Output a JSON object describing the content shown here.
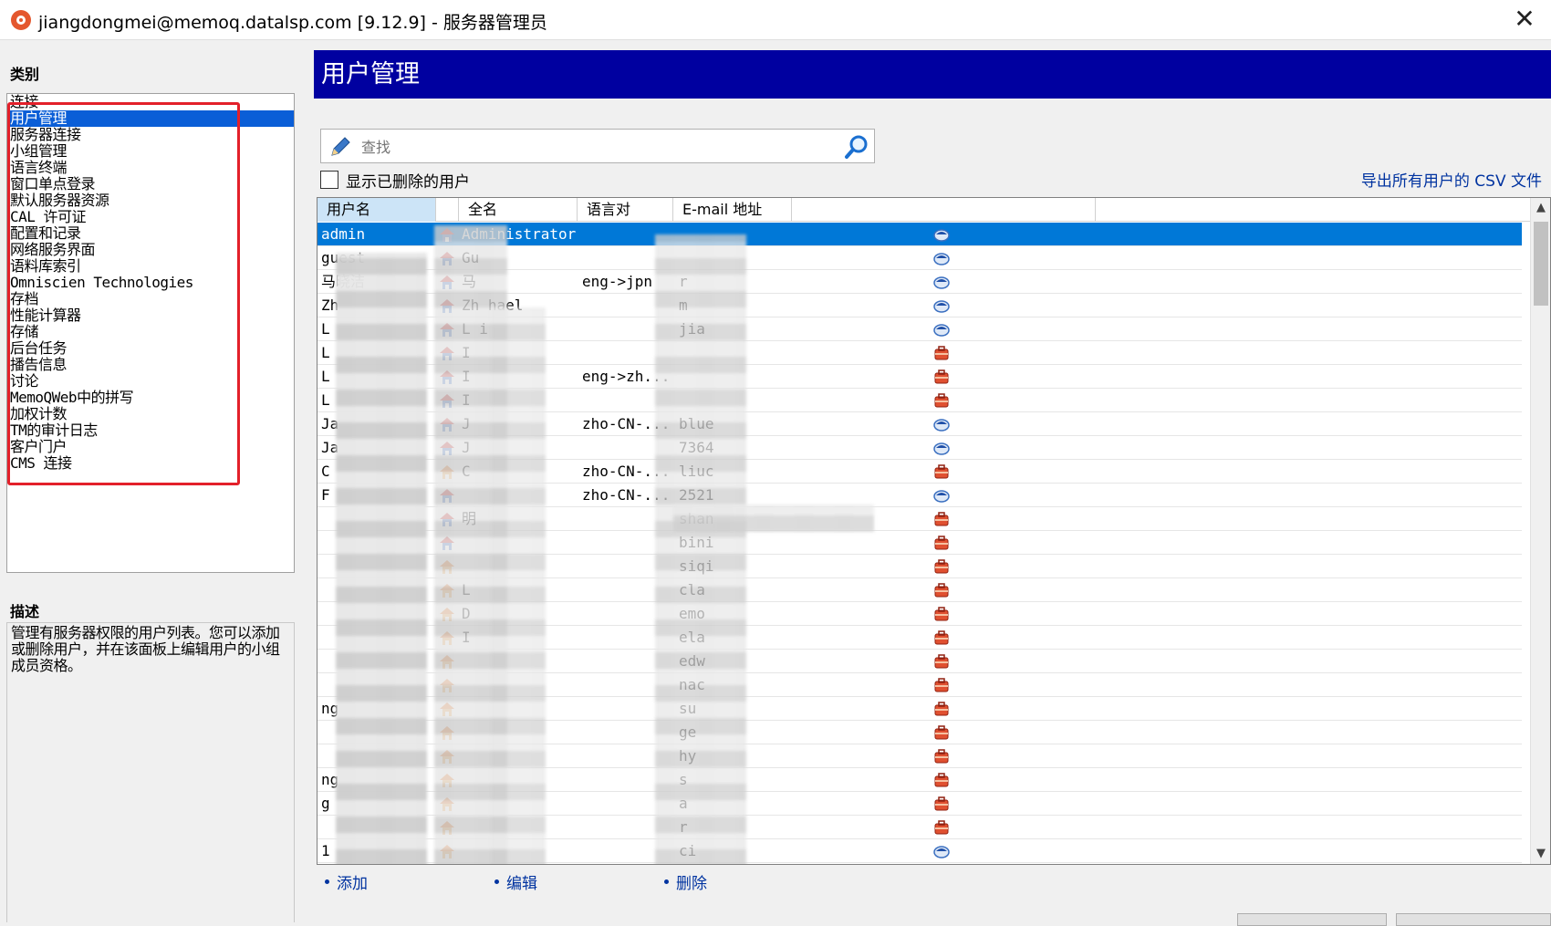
{
  "window": {
    "title": "jiangdongmei@memoq.datalsp.com [9.12.9] - 服务器管理员",
    "close_glyph": "✕"
  },
  "left": {
    "category_heading": "类别",
    "categories": [
      "连接",
      "用户管理",
      "服务器连接",
      "小组管理",
      "语言终端",
      "窗口单点登录",
      "默认服务器资源",
      "CAL 许可证",
      "配置和记录",
      "网络服务界面",
      "语料库索引",
      "Omniscien Technologies",
      "存档",
      "性能计算器",
      "存储",
      "后台任务",
      "播告信息",
      "讨论",
      "MemoQWeb中的拼写",
      "加权计数",
      "TM的审计日志",
      "客户门户",
      "CMS 连接"
    ],
    "selected_index": 1,
    "description_heading": "描述",
    "description": "管理有服务器权限的用户列表。您可以添加或删除用户，并在该面板上编辑用户的小组成员资格。"
  },
  "main": {
    "header": "用户管理",
    "search_placeholder": "查找",
    "show_deleted_label": "显示已删除的用户",
    "export_link": "导出所有用户的 CSV 文件",
    "columns": [
      "用户名",
      "全名",
      "语言对",
      "E-mail 地址"
    ],
    "rows": [
      {
        "user": "admin",
        "full": "Administrator",
        "lang": "",
        "mail": "",
        "home": "blue",
        "type": "cloud"
      },
      {
        "user": "guest",
        "full": "Gu",
        "lang": "",
        "mail": "",
        "home": "blue",
        "type": "cloud"
      },
      {
        "user": "马晓洁",
        "full": "马",
        "lang": "eng->jpn",
        "mail": "r",
        "home": "blue",
        "type": "cloud"
      },
      {
        "user": "Zh",
        "full": "Zh      hael",
        "lang": "",
        "mail": "m",
        "home": "blue",
        "type": "cloud"
      },
      {
        "user": "L",
        "full": "L       i",
        "lang": "",
        "mail": "jia",
        "home": "blue",
        "type": "cloud"
      },
      {
        "user": "L",
        "full": "I",
        "lang": "",
        "mail": "",
        "home": "blue",
        "type": "bag"
      },
      {
        "user": "L",
        "full": "I",
        "lang": "eng->zh...",
        "mail": "",
        "home": "blue",
        "type": "bag"
      },
      {
        "user": "L",
        "full": "I",
        "lang": "",
        "mail": "",
        "home": "blue",
        "type": "bag"
      },
      {
        "user": "Ja",
        "full": "J",
        "lang": "zho-CN-...",
        "mail": "blue",
        "home": "blue",
        "type": "cloud"
      },
      {
        "user": "Ja",
        "full": "J",
        "lang": "",
        "mail": "7364",
        "home": "blue",
        "type": "cloud"
      },
      {
        "user": "C",
        "full": "C",
        "lang": "zho-CN-...",
        "mail": "liuc",
        "home": "orange",
        "type": "bag"
      },
      {
        "user": "F",
        "full": "",
        "lang": "zho-CN-...",
        "mail": "2521",
        "home": "blue",
        "type": "cloud"
      },
      {
        "user": "",
        "full": "         明",
        "lang": "",
        "mail": "shan",
        "home": "blue",
        "type": "bag"
      },
      {
        "user": "",
        "full": "",
        "lang": "",
        "mail": "bini",
        "home": "blue",
        "type": "bag"
      },
      {
        "user": "",
        "full": "",
        "lang": "",
        "mail": "siqi",
        "home": "orange",
        "type": "bag"
      },
      {
        "user": "",
        "full": "L",
        "lang": "",
        "mail": "cla",
        "home": "orange",
        "type": "bag"
      },
      {
        "user": "",
        "full": "D",
        "lang": "",
        "mail": "emo",
        "home": "orange",
        "type": "bag"
      },
      {
        "user": "",
        "full": "I",
        "lang": "",
        "mail": "ela",
        "home": "orange",
        "type": "bag"
      },
      {
        "user": "",
        "full": "",
        "lang": "",
        "mail": "edw",
        "home": "orange",
        "type": "bag"
      },
      {
        "user": "",
        "full": "",
        "lang": "",
        "mail": "nac",
        "home": "orange",
        "type": "bag"
      },
      {
        "user": "        ng",
        "full": "",
        "lang": "",
        "mail": "su",
        "home": "orange",
        "type": "bag"
      },
      {
        "user": "",
        "full": "",
        "lang": "",
        "mail": "ge",
        "home": "orange",
        "type": "bag"
      },
      {
        "user": "",
        "full": "",
        "lang": "",
        "mail": "hy",
        "home": "orange",
        "type": "bag"
      },
      {
        "user": "        ng",
        "full": "",
        "lang": "",
        "mail": "s",
        "home": "orange",
        "type": "bag"
      },
      {
        "user": "        g",
        "full": "",
        "lang": "",
        "mail": "a",
        "home": "orange",
        "type": "bag"
      },
      {
        "user": "",
        "full": "",
        "lang": "",
        "mail": "r",
        "home": "orange",
        "type": "bag"
      },
      {
        "user": "       1",
        "full": "",
        "lang": "",
        "mail": "ci",
        "home": "orange",
        "type": "cloud"
      }
    ],
    "actions": {
      "add": "添加",
      "edit": "编辑",
      "delete": "删除"
    }
  },
  "colors": {
    "header_bg": "#0000a0",
    "selection": "#0078d7",
    "highlight_box": "#e3202a",
    "link": "#0033a0"
  }
}
